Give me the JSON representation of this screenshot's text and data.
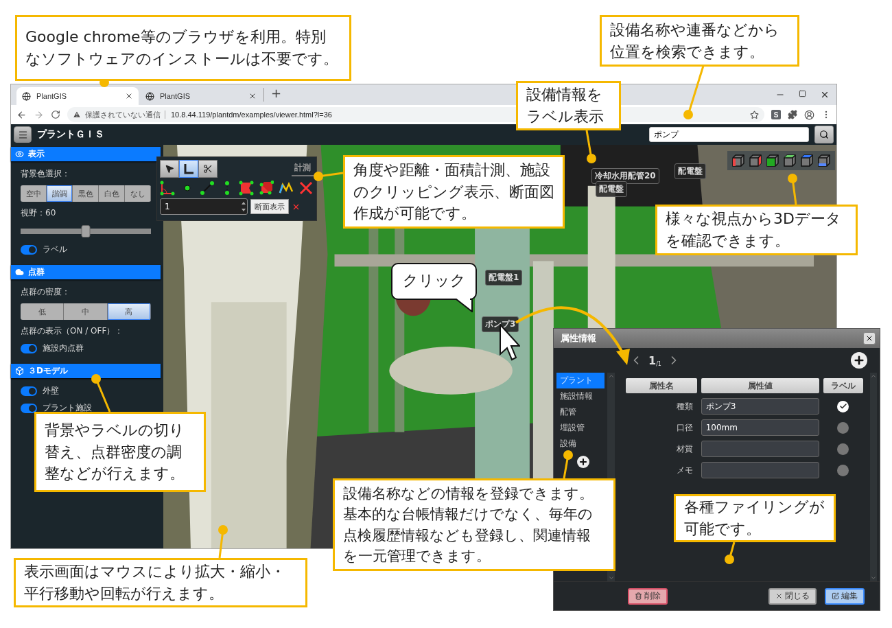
{
  "browser": {
    "tabs": [
      {
        "title": "PlantGIS",
        "selected": true
      },
      {
        "title": "PlantGIS",
        "selected": false
      }
    ],
    "new_tab": "+",
    "security_warning": "保護されていない通信",
    "url": "10.8.44.119/plantdm/examples/viewer.html?l=36",
    "extension_badge": "S"
  },
  "app": {
    "title": "プラントＧＩＳ",
    "search": {
      "value": "ポンプ"
    }
  },
  "sidebar": {
    "sections": [
      {
        "title": "表示",
        "controls": [
          {
            "kind": "segmented",
            "label": "背景色選択：",
            "options": [
              {
                "label": "空中",
                "selected": false
              },
              {
                "label": "諧調",
                "selected": true
              },
              {
                "label": "黒色",
                "selected": false
              },
              {
                "label": "白色",
                "selected": false
              },
              {
                "label": "なし",
                "selected": false
              }
            ]
          },
          {
            "kind": "slider",
            "label": "視野：60",
            "level": 0.5
          },
          {
            "kind": "toggle",
            "label": "ラベル",
            "on": true
          }
        ]
      },
      {
        "title": "点群",
        "controls": [
          {
            "kind": "segmented",
            "label": "点群の密度：",
            "options": [
              {
                "label": "低",
                "selected": false
              },
              {
                "label": "中",
                "selected": false
              },
              {
                "label": "高",
                "selected": true
              }
            ]
          },
          {
            "kind": "heading",
            "label": "点群の表示（ON / OFF）："
          },
          {
            "kind": "toggle",
            "label": "施設内点群",
            "on": true
          }
        ]
      },
      {
        "title": "３Dモデル",
        "controls": [
          {
            "kind": "toggle",
            "label": "外壁",
            "on": true
          },
          {
            "kind": "toggle",
            "label": "プラント施設",
            "on": true
          }
        ]
      }
    ]
  },
  "measure_panel": {
    "tools": [
      {
        "kind": "pointer",
        "selected": false
      },
      {
        "kind": "ruler",
        "selected": true
      },
      {
        "kind": "scissors",
        "selected": false
      }
    ],
    "title": "計測",
    "count": "1",
    "section_button": "断面表示"
  },
  "scene_labels": [
    {
      "text": "冷却水用配管20"
    },
    {
      "text": "配電盤"
    },
    {
      "text": "配電盤"
    },
    {
      "text": "配電盤1"
    },
    {
      "text": "ポンプ3"
    }
  ],
  "dialog": {
    "title": "属性情報",
    "page": "1",
    "page_total": "/1",
    "categories": [
      {
        "label": "プラント",
        "selected": true
      },
      {
        "label": "施設情報",
        "selected": false
      },
      {
        "label": "配管",
        "selected": false
      },
      {
        "label": "埋設管",
        "selected": false
      },
      {
        "label": "設備",
        "selected": false
      }
    ],
    "columns": [
      "属性名",
      "属性値",
      "ラベル"
    ],
    "rows": [
      {
        "name": "種類",
        "value": "ポンプ3",
        "label_shown": true
      },
      {
        "name": "口径",
        "value": "100mm",
        "label_shown": false
      },
      {
        "name": "材質",
        "label_shown": false
      },
      {
        "name": "メモ",
        "label_shown": false
      }
    ],
    "buttons": [
      {
        "kind": "delete",
        "label": "削除"
      },
      {
        "kind": "close",
        "label": "閉じる"
      },
      {
        "kind": "edit",
        "label": "編集"
      }
    ]
  },
  "callouts": [
    {
      "kind": "box",
      "text": "Google chrome等のブラウザを利用。特別なソフトウェアのインストールは不要です。"
    },
    {
      "kind": "box",
      "text": "設備名称や連番などから位置を検索できます。"
    },
    {
      "kind": "box",
      "text": "設備情報をラベル表示"
    },
    {
      "kind": "box",
      "text": "角度や距離・面積計測、施設のクリッピング表示、断面図作成が可能です。"
    },
    {
      "kind": "box",
      "text": "様々な視点から3Dデータを確認できます。"
    },
    {
      "kind": "bubble",
      "text": "クリック"
    },
    {
      "kind": "box",
      "text": "背景やラベルの切り替え、点群密度の調整などが行えます。"
    },
    {
      "kind": "box",
      "text": "設備名称などの情報を登録できます。基本的な台帳情報だけでなく、毎年の点検履歴情報なども登録し、関連情報を一元管理できます。"
    },
    {
      "kind": "box",
      "text": "各種ファイリングが可能です。"
    },
    {
      "kind": "box",
      "text": "表示画面はマウスにより拡大・縮小・平行移動や回転が行えます。"
    }
  ]
}
